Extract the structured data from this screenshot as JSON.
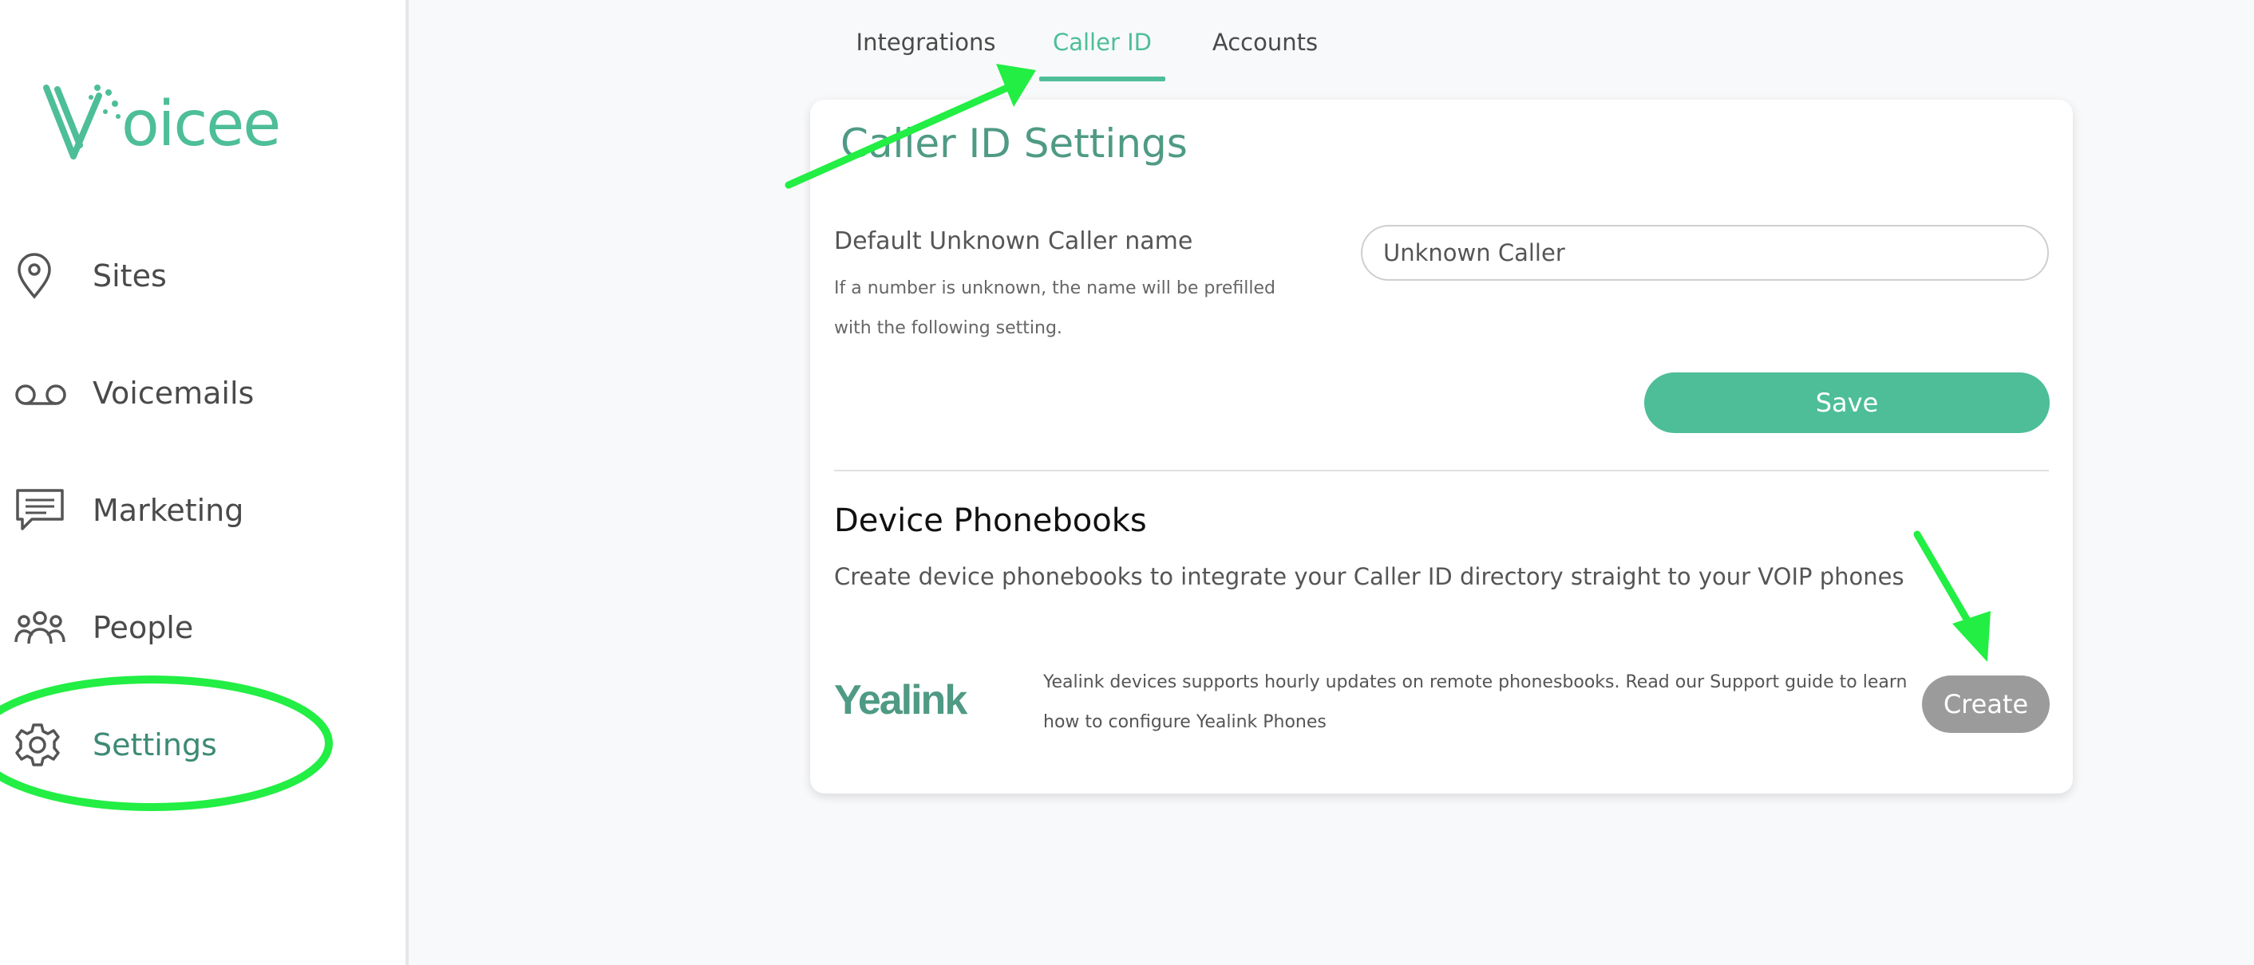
{
  "brand": {
    "name": "Voicee",
    "accent": "#4dbe98",
    "dark_accent": "#3d8a75"
  },
  "sidebar": {
    "items": [
      {
        "label": "Sites",
        "icon": "map-pin-icon"
      },
      {
        "label": "Voicemails",
        "icon": "voicemail-icon"
      },
      {
        "label": "Marketing",
        "icon": "chat-bubble-icon"
      },
      {
        "label": "People",
        "icon": "people-icon"
      },
      {
        "label": "Settings",
        "icon": "gear-icon",
        "active": true
      }
    ]
  },
  "tabs": [
    {
      "label": "Integrations"
    },
    {
      "label": "Caller ID",
      "active": true
    },
    {
      "label": "Accounts"
    }
  ],
  "caller_id": {
    "title": "Caller ID Settings",
    "default_label": "Default Unknown Caller name",
    "default_help": "If a number is unknown, the name will be prefilled with the following setting.",
    "default_value": "Unknown Caller",
    "save_label": "Save"
  },
  "phonebooks": {
    "title": "Device Phonebooks",
    "description": "Create device phonebooks to integrate your Caller ID directory straight to your VOIP phones",
    "yealink": {
      "logo_text": "Yealink",
      "description": "Yealink devices supports hourly updates on remote phonesbooks. Read our Support guide to learn how to configure Yealink Phones",
      "create_label": "Create"
    }
  },
  "annotations": {
    "color": "#22ee44"
  }
}
